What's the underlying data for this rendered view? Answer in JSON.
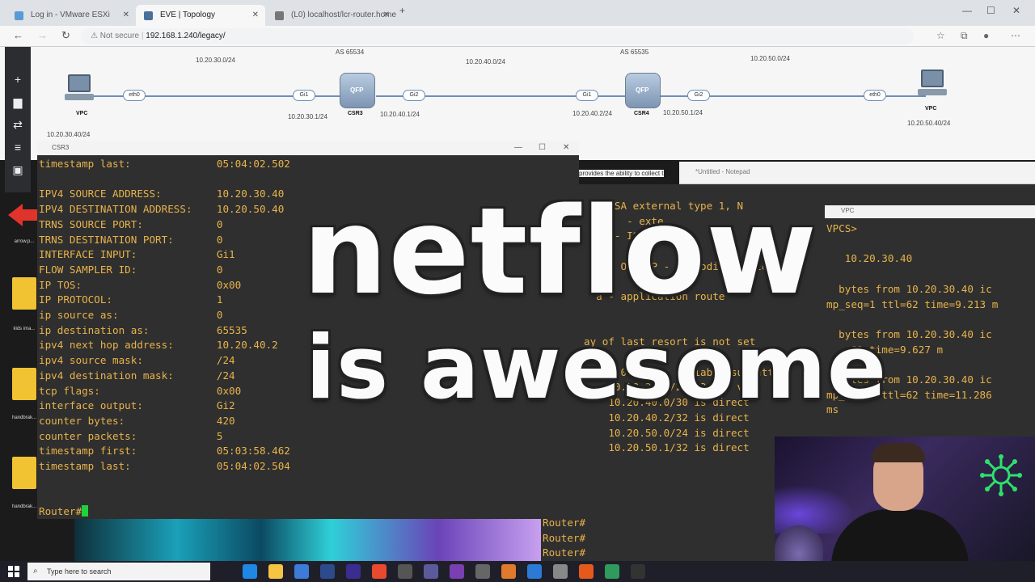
{
  "browser": {
    "tabs": [
      {
        "label": "Log in - VMware ESXi"
      },
      {
        "label": "EVE | Topology"
      },
      {
        "label": "(L0) localhost/lcr-router.home"
      }
    ],
    "address": {
      "security": "Not secure",
      "url": "192.168.1.240/legacy/"
    }
  },
  "topology": {
    "subnets": [
      "10.20.30.0/24",
      "10.20.40.0/24",
      "10.20.50.0/24"
    ],
    "as_labels": [
      "AS 65534",
      "AS 65535"
    ],
    "devices": [
      {
        "name": "VPC",
        "ip": "10.20.30.40/24"
      },
      {
        "name": "CSR3"
      },
      {
        "name": "CSR4"
      },
      {
        "name": "VPC",
        "ip": "10.20.50.40/24"
      }
    ],
    "ports": [
      "eth0",
      "Gi1",
      "Gi2",
      "Gi1",
      "Gi2",
      "eth0"
    ],
    "ip_labels": [
      "10.20.30.1/24",
      "10.20.40.1/24",
      "10.20.40.2/24",
      "10.20.50.1/24"
    ],
    "router_badge": "QFP"
  },
  "desktop": {
    "icons": [
      "arrow.p...",
      "kids ima...",
      "handbrak...",
      "handbrak..."
    ]
  },
  "terminal_left": {
    "title": "CSR3",
    "lines": [
      "timestamp last:              05:04:02.502",
      "",
      "IPV4 SOURCE ADDRESS:         10.20.30.40",
      "IPV4 DESTINATION ADDRESS:    10.20.50.40",
      "TRNS SOURCE PORT:            0",
      "TRNS DESTINATION PORT:       0",
      "INTERFACE INPUT:             Gi1",
      "FLOW SAMPLER ID:             0",
      "IP TOS:                      0x00",
      "IP PROTOCOL:                 1",
      "ip source as:                0",
      "ip destination as:           65535",
      "ipv4 next hop address:       10.20.40.2",
      "ipv4 source mask:            /24",
      "ipv4 destination mask:       /24",
      "tcp flags:                   0x00",
      "interface output:            Gi2",
      "counter bytes:               420",
      "counter packets:             5",
      "timestamp first:             05:03:58.462",
      "timestamp last:              05:04:02.504",
      "",
      "",
      "Router#"
    ]
  },
  "terminal_right": {
    "lines": [
      "   OSSA external type 1, N",
      "       - exte",
      "  15 - IS",
      "",
      "  o - ODR, P - periodic downloaded",
      "",
      "  a - application route",
      "",
      "",
      "ay of last resort is not set",
      "",
      " 10.0.0.0/8 is variably subnetted,",
      "    10.20.30.0/24 [20/0] vi",
      "    10.20.40.0/30 is direct",
      "    10.20.40.2/32 is direct",
      "    10.20.50.0/24 is direct",
      "    10.20.50.1/32 is direct"
    ],
    "prompts": [
      "Router#",
      "Router#",
      "Router#"
    ],
    "snippet": "provides the ability to collect t"
  },
  "vpc_window": {
    "title": "VPC",
    "lines": [
      "VPCS>",
      "",
      "   10.20.30.40",
      "",
      "  bytes from 10.20.30.40 ic",
      "mp_seq=1 ttl=62 time=9.213 m",
      "",
      "  bytes from 10.20.30.40 ic",
      "   =62 time=9.627 m",
      "",
      "  bytes from 10.20.30.40 ic",
      "mp_seq=3 ttl=62 time=11.286",
      "ms"
    ]
  },
  "notepad": {
    "title": "*Untitled - Notepad"
  },
  "overlay": {
    "line1": "netflow",
    "line2": "is awesome"
  },
  "taskbar": {
    "search_placeholder": "Type here to search",
    "apps": [
      "edge",
      "explorer",
      "vscode",
      "ps",
      "pr",
      "chrome",
      "app",
      "app",
      "onenote",
      "app",
      "app",
      "vscode",
      "app",
      "firefox",
      "app",
      "terminal"
    ]
  },
  "colors": {
    "terminal_text": "#e8b34b",
    "cursor": "#1fd13b",
    "accent_red": "#e0332b"
  }
}
